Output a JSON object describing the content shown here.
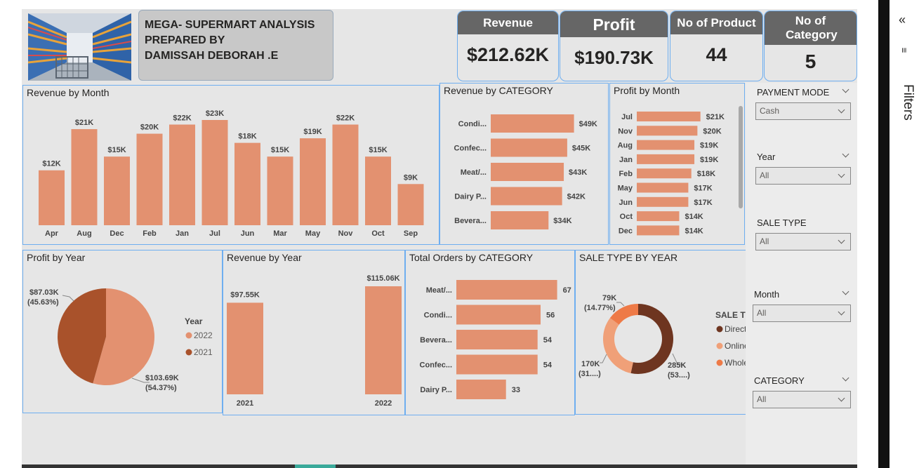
{
  "header": {
    "title_line1": "MEGA- SUPERMART ANALYSIS",
    "title_line2": "PREPARED BY",
    "title_line3": "DAMISSAH DEBORAH .E"
  },
  "kpis": [
    {
      "label": "Revenue",
      "value": "$212.62K"
    },
    {
      "label": "Profit",
      "value": "$190.73K"
    },
    {
      "label": "No of Product",
      "value": "44"
    },
    {
      "label": "No of Category",
      "value": "5"
    }
  ],
  "filters_pane": {
    "label": "Filters",
    "collapse_icon": "double-chevron-left-icon",
    "filter_icon": "filter-icon"
  },
  "slicers": [
    {
      "label": "PAYMENT MODE",
      "value": "Cash"
    },
    {
      "label": "Year",
      "value": "All"
    },
    {
      "label": "SALE TYPE",
      "value": "All"
    },
    {
      "label": "Month",
      "value": "All"
    },
    {
      "label": "CATEGORY",
      "value": "All"
    }
  ],
  "colors": {
    "accent": "#e39170",
    "dark": "#a9522b",
    "darkest": "#6e3520",
    "mid": "#ee7a47",
    "canvas": "#e6e6e6",
    "border": "#6eaef0"
  },
  "chart_data": [
    {
      "id": "revenue_by_month",
      "type": "bar",
      "title": "Revenue by Month",
      "categories": [
        "Apr",
        "Aug",
        "Dec",
        "Feb",
        "Jan",
        "Jul",
        "Jun",
        "Mar",
        "May",
        "Nov",
        "Oct",
        "Sep"
      ],
      "values": [
        12,
        21,
        15,
        20,
        22,
        23,
        18,
        15,
        19,
        22,
        15,
        9
      ],
      "labels": [
        "$12K",
        "$21K",
        "$15K",
        "$20K",
        "$22K",
        "$23K",
        "$18K",
        "$15K",
        "$19K",
        "$22K",
        "$15K",
        "$9K"
      ],
      "ylim": [
        0,
        25
      ]
    },
    {
      "id": "revenue_by_category",
      "type": "bar",
      "orientation": "horizontal",
      "title": "Revenue by CATEGORY",
      "categories": [
        "Condi...",
        "Confec...",
        "Meat/...",
        "Dairy P...",
        "Bevera..."
      ],
      "values": [
        49,
        45,
        43,
        42,
        34
      ],
      "labels": [
        "$49K",
        "$45K",
        "$43K",
        "$42K",
        "$34K"
      ],
      "xlim": [
        0,
        50
      ]
    },
    {
      "id": "profit_by_month",
      "type": "bar",
      "orientation": "horizontal",
      "title": "Profit by Month",
      "categories": [
        "Jul",
        "Nov",
        "Aug",
        "Jan",
        "Feb",
        "May",
        "Jun",
        "Oct",
        "Dec"
      ],
      "values": [
        21,
        20,
        19,
        19,
        18,
        17,
        17,
        14,
        14
      ],
      "labels": [
        "$21K",
        "$20K",
        "$19K",
        "$19K",
        "$18K",
        "$17K",
        "$17K",
        "$14K",
        "$14K"
      ],
      "xlim": [
        0,
        22
      ]
    },
    {
      "id": "profit_by_year",
      "type": "pie",
      "title": "Profit by Year",
      "legend_title": "Year",
      "legend_position": "right",
      "categories": [
        "2022",
        "2021"
      ],
      "values": [
        103.69,
        87.03
      ],
      "labels": [
        "$103.69K",
        "$87.03K"
      ],
      "percents": [
        "(54.37%)",
        "(45.63%)"
      ],
      "colors": [
        "#e39170",
        "#a9522b"
      ]
    },
    {
      "id": "revenue_by_year",
      "type": "bar",
      "title": "Revenue by Year",
      "categories": [
        "2021",
        "2022"
      ],
      "values": [
        97.55,
        115.06
      ],
      "labels": [
        "$97.55K",
        "$115.06K"
      ],
      "ylim": [
        0,
        120
      ]
    },
    {
      "id": "orders_by_category",
      "type": "bar",
      "orientation": "horizontal",
      "title": "Total Orders by CATEGORY",
      "categories": [
        "Meat/...",
        "Condi...",
        "Bevera...",
        "Confec...",
        "Dairy P..."
      ],
      "values": [
        67,
        56,
        54,
        54,
        33
      ],
      "labels": [
        "67",
        "56",
        "54",
        "54",
        "33"
      ],
      "xlim": [
        0,
        70
      ]
    },
    {
      "id": "sale_type_by_year",
      "type": "pie",
      "donut": true,
      "title": "SALE TYPE BY YEAR",
      "legend_title": "SALE TYPE",
      "legend_position": "right",
      "categories": [
        "Direct ...",
        "Online",
        "Wholes..."
      ],
      "values": [
        285,
        170,
        79
      ],
      "labels": [
        "285K",
        "170K",
        "79K"
      ],
      "percents": [
        "(53....)",
        "(31....)",
        "(14.77%)"
      ],
      "colors": [
        "#6e3520",
        "#f0a078",
        "#ee7a47"
      ]
    }
  ]
}
